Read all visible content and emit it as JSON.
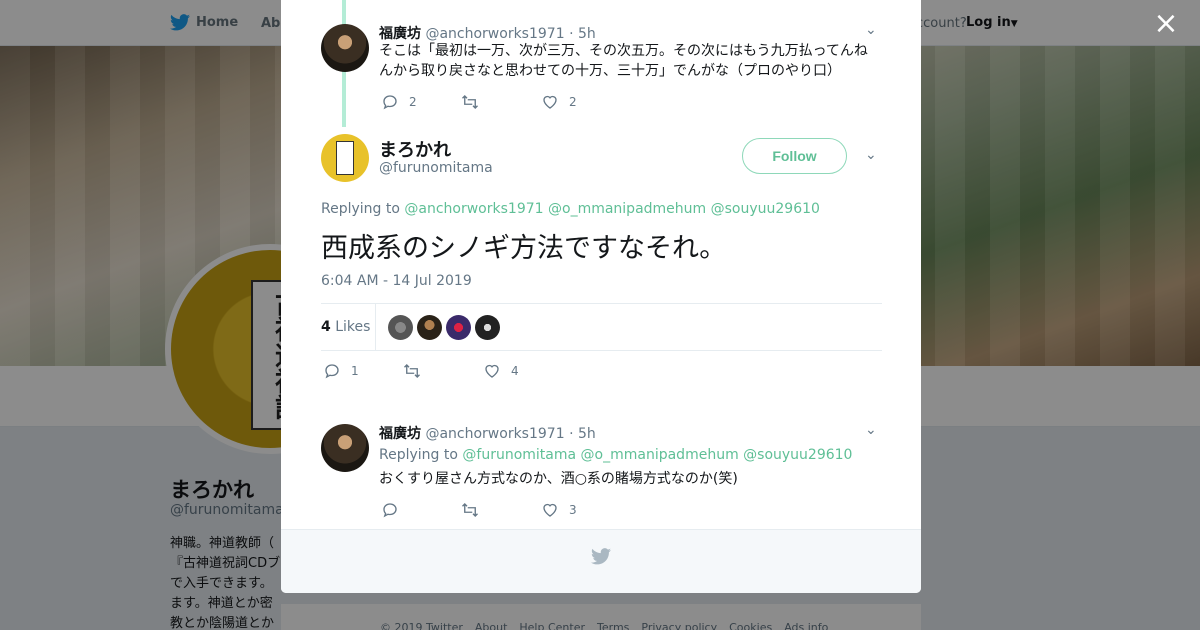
{
  "nav": {
    "home": "Home",
    "about": "Abo",
    "account": "ccount?",
    "login": "Log in"
  },
  "profile": {
    "name": "まろかれ",
    "handle": "@furunomitama",
    "bio": "神職。神道教師（ 『古神道祝詞CDブ で入手できます。 ます。神道とか密教とか陰陽道とか仙道 に反応します。道",
    "avatar_text": "古神道祝詞"
  },
  "footer": {
    "links": [
      "© 2019 Twitter",
      "About",
      "Help Center",
      "Terms",
      "Privacy policy",
      "Cookies",
      "Ads info"
    ]
  },
  "close_label": "×",
  "ancestor_tweet": {
    "name": "福廣坊",
    "handle": "@anchorworks1971",
    "time": "· 5h",
    "text": "そこは「最初は一万、次が三万、その次五万。その次にはもう九万払ってんねんから取り戻さなと思わせての十万、三十万」でんがな（プロのやり口）",
    "replies": "2",
    "retweets": "",
    "likes": "2"
  },
  "main_tweet": {
    "name": "まろかれ",
    "handle": "@furunomitama",
    "follow_label": "Follow",
    "replying_prefix": "Replying to",
    "mentions": [
      "@anchorworks1971",
      "@o_mmanipadmehum",
      "@souyuu29610"
    ],
    "text": "西成系のシノギ方法ですなそれ。",
    "timestamp": "6:04 AM - 14 Jul 2019",
    "likes_count": "4",
    "likes_label": "Likes",
    "replies": "1",
    "retweets": "",
    "likes": "4"
  },
  "reply_tweet": {
    "name": "福廣坊",
    "handle": "@anchorworks1971",
    "time": "· 5h",
    "replying_prefix": "Replying to",
    "mentions": [
      "@furunomitama",
      "@o_mmanipadmehum",
      "@souyuu29610"
    ],
    "text": "おくすり屋さん方式なのか、酒○系の賭場方式なのか(笑)",
    "replies": "",
    "retweets": "",
    "likes": "3"
  },
  "colors": {
    "accent": "#5fbf96",
    "thread_line": "#b4ecd6",
    "twitter_blue": "#1da1f2"
  }
}
